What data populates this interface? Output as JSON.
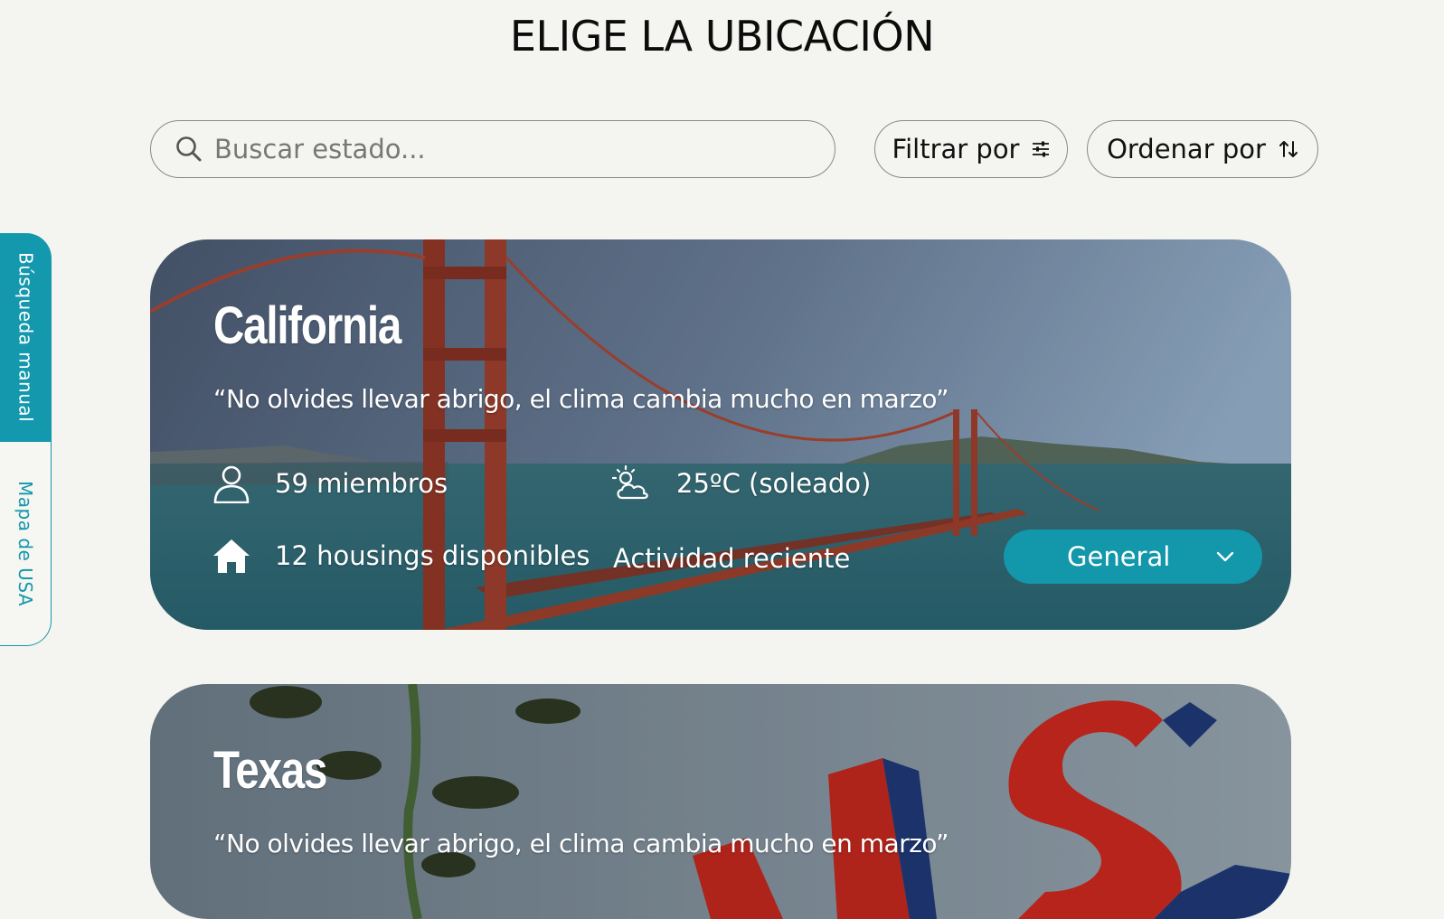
{
  "page": {
    "title": "ELIGE LA UBICACIÓN"
  },
  "search": {
    "placeholder": "Buscar estado..."
  },
  "toolbar": {
    "filter_label": "Filtrar por",
    "sort_label": "Ordenar por"
  },
  "side_tabs": [
    {
      "label": "Búsqueda manual",
      "active": true
    },
    {
      "label": "Mapa de USA",
      "active": false
    }
  ],
  "cards": [
    {
      "name": "California",
      "quote": "“No olvides llevar abrigo, el clima cambia mucho en marzo”",
      "members": "59 miembros",
      "weather": "25ºC (soleado)",
      "housing": "12 housings disponibles",
      "activity": "Actividad reciente",
      "selector": "General"
    },
    {
      "name": "Texas",
      "quote": "“No olvides llevar abrigo, el clima cambia mucho en marzo”"
    }
  ],
  "colors": {
    "accent": "#1498ad",
    "background": "#f4f4f0"
  }
}
